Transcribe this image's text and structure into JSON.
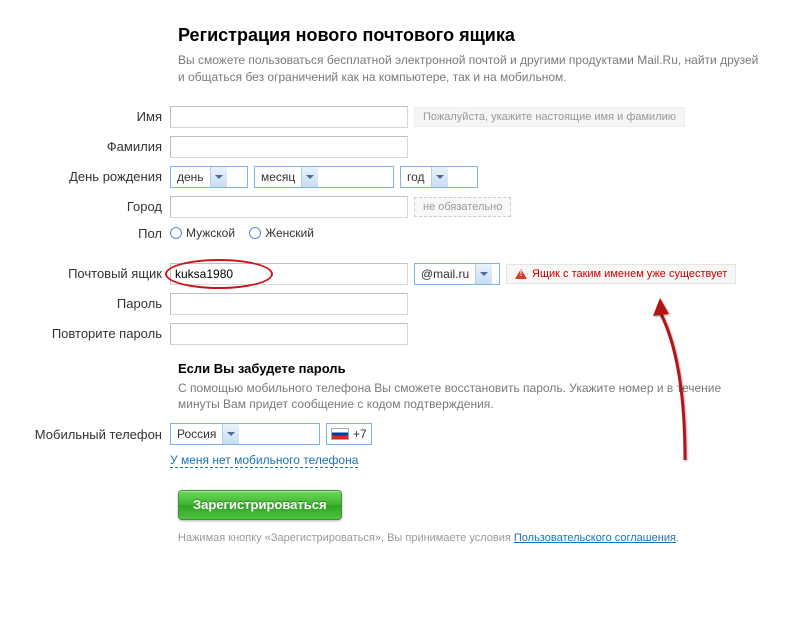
{
  "header": {
    "title": "Регистрация нового почтового ящика",
    "subtitle": "Вы сможете пользоваться бесплатной электронной почтой и другими продуктами Mail.Ru, найти друзей и общаться без ограничений как на компьютере, так и на мобильном."
  },
  "labels": {
    "firstname": "Имя",
    "lastname": "Фамилия",
    "birthday": "День рождения",
    "city": "Город",
    "gender": "Пол",
    "mailbox": "Почтовый ящик",
    "password": "Пароль",
    "password2": "Повторите пароль",
    "phone": "Мобильный телефон"
  },
  "birthday": {
    "day": "день",
    "month": "месяц",
    "year": "год"
  },
  "city_hint": "не обязательно",
  "gender": {
    "male": "Мужской",
    "female": "Женский"
  },
  "mailbox": {
    "value": "kuksa1980",
    "domain": "@mail.ru",
    "error": "Ящик с таким именем уже существует"
  },
  "name_hint": "Пожалуйста, укажите настоящие имя и фамилию",
  "recover": {
    "title": "Если Вы забудете пароль",
    "text": "С помощью мобильного телефона Вы сможете восстановить пароль. Укажите номер и в течение минуты Вам придет сообщение с кодом подтверждения."
  },
  "phone": {
    "country": "Россия",
    "prefix": "+7"
  },
  "no_phone_link": "У меня нет мобильного телефона",
  "register_btn": "Зарегистрироваться",
  "tos": {
    "prefix": "Нажимая кнопку «Зарегистрироваться», Вы принимаете условия ",
    "link": "Пользовательского соглашения",
    "suffix": "."
  }
}
